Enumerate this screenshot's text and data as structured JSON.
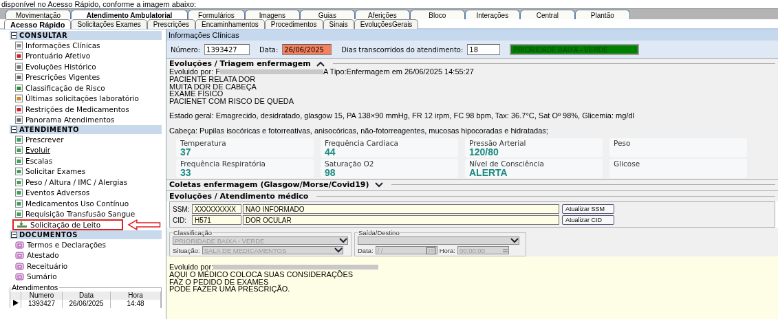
{
  "caption": "disponível no Acesso Rápido, conforme a imagem abaixo:",
  "tabs": [
    {
      "label": "Movimentação",
      "selected": false
    },
    {
      "label": "Atendimento Ambulatorial",
      "selected": true
    },
    {
      "label": "Formulários",
      "selected": false
    },
    {
      "label": "Imagens",
      "selected": false
    },
    {
      "label": "Guias",
      "selected": false
    },
    {
      "label": "Aferições",
      "selected": false
    },
    {
      "label": "Bloco",
      "selected": false
    },
    {
      "label": "Interações",
      "selected": false
    },
    {
      "label": "Central",
      "selected": false
    },
    {
      "label": "Plantão",
      "selected": false
    }
  ],
  "subtabs": [
    {
      "label": "Acesso Rápido",
      "selected": true
    },
    {
      "label": "Solicitações Exames",
      "selected": false
    },
    {
      "label": "Prescrições",
      "selected": false
    },
    {
      "label": "Encaminhamentos",
      "selected": false
    },
    {
      "label": "Procedimentos",
      "selected": false
    },
    {
      "label": "Sinais",
      "selected": false
    },
    {
      "label": "EvoluçõesGerais",
      "selected": false
    }
  ],
  "sidebar": {
    "sections": [
      {
        "title": "CONSULTAR",
        "expanded": true,
        "items": [
          {
            "label": "Informações Clínicas",
            "hovered": false,
            "highlighted": false
          },
          {
            "label": "Prontuário Afetivo",
            "hovered": false,
            "highlighted": false
          },
          {
            "label": "Evoluções Histórico",
            "hovered": false,
            "highlighted": false
          },
          {
            "label": "Prescrições Vigentes",
            "hovered": false,
            "highlighted": false
          },
          {
            "label": "Classificação de Risco",
            "hovered": false,
            "highlighted": false
          },
          {
            "label": "Últimas solicitações laboratório",
            "hovered": false,
            "highlighted": false
          },
          {
            "label": "Restrições de Medicamentos",
            "hovered": false,
            "highlighted": false
          },
          {
            "label": "Panorama Atendimentos",
            "hovered": false,
            "highlighted": false
          }
        ]
      },
      {
        "title": "ATENDIMENTO",
        "expanded": true,
        "items": [
          {
            "label": "Prescrever",
            "hovered": false,
            "highlighted": false
          },
          {
            "label": "Evoluir",
            "hovered": true,
            "highlighted": false
          },
          {
            "label": "Escalas",
            "hovered": false,
            "highlighted": false
          },
          {
            "label": "Solicitar Exames",
            "hovered": false,
            "highlighted": false
          },
          {
            "label": "Peso / Altura / IMC / Alergias",
            "hovered": false,
            "highlighted": false
          },
          {
            "label": "Eventos Adversos",
            "hovered": false,
            "highlighted": false
          },
          {
            "label": "Medicamentos Uso Contínuo",
            "hovered": false,
            "highlighted": false
          },
          {
            "label": "Requisição Transfusão Sangue",
            "hovered": false,
            "highlighted": false
          },
          {
            "label": "Solicitação de Leito",
            "hovered": false,
            "highlighted": true
          }
        ]
      },
      {
        "title": "DOCUMENTOS",
        "expanded": true,
        "items": [
          {
            "label": "Termos e Declarações",
            "hovered": false,
            "highlighted": false
          },
          {
            "label": "Atestado",
            "hovered": false,
            "highlighted": false
          },
          {
            "label": "Receituário",
            "hovered": false,
            "highlighted": false
          },
          {
            "label": "Sumário",
            "hovered": false,
            "highlighted": false
          }
        ]
      }
    ],
    "atendimentos": {
      "title": "Atendimentos",
      "columns": [
        "Numero",
        "Data",
        "Hora"
      ],
      "rows": [
        {
          "cells": [
            "1393427",
            "26/06/2025",
            "14:48"
          ],
          "selected": true
        }
      ]
    }
  },
  "panel_title": "Informações Clínicas",
  "header_fields": [
    {
      "label": "Número:",
      "value": "1393427",
      "color": "#ffffff"
    },
    {
      "label": "Data:",
      "value": "26/06/2025",
      "color": "#f4805f"
    },
    {
      "label": "Dias transcorridos do atendimento:",
      "value": "18",
      "color": "#ffffff"
    }
  ],
  "priority": {
    "value": "PRIORIDADE BAIXA - VERDE",
    "color": "#008000"
  },
  "triagem": {
    "title": "Evoluções / Triagem enfermagem",
    "expanded": true,
    "author_start": "Evoluido por: F",
    "author_end": "A Tipo:Enfermagem em 26/06/2025 14:55:27",
    "lines": [
      "PACIENTE RELATA DOR",
      "MUITA DOR DE CABEÇA",
      "EXAME FÍSICO",
      "PACIENET COM RISCO DE QUEDA"
    ],
    "paragraphs": [
      "Estado geral: Emagrecido, desidratado, glasgow 15, PA 138×90 mmHg, FR 12 irpm, FC 98 bpm, Tax: 36.7°C, Sat Oº 98%, Glicemia: mg/dl",
      "Cabeça: Pupilas isocóricas e fotorreativas, anisocóricas, não-fotorreagentes, mucosas hipocoradas e hidratadas;"
    ],
    "vitals": [
      {
        "label": "Temperatura",
        "value": "37"
      },
      {
        "label": "Frequência Cardiaca",
        "value": "44"
      },
      {
        "label": "Pressão Arterial",
        "value": "120/80"
      },
      {
        "label": "Peso"
      },
      {
        "label": "Frequência Respiratória",
        "value": "33"
      },
      {
        "label": "Saturação O2",
        "value": "98"
      },
      {
        "label": "Nível de Consciência",
        "value": "ALERTA"
      },
      {
        "label": "Glicose"
      }
    ]
  },
  "coletas": {
    "title": "Coletas enfermagem  (Glasgow/Morse/Covid19)",
    "expanded": false
  },
  "medico": {
    "title": "Evoluções / Atendimento médico",
    "codes": [
      {
        "label": "SSM:",
        "code": "XXXXXXXXX",
        "description": "NAO INFORMADO",
        "button": "Atualizar SSM"
      },
      {
        "label": "CID:",
        "code": "H571",
        "description": "DOR OCULAR",
        "button": "Atualizar CID"
      }
    ],
    "classificacao": {
      "title": "Classificação",
      "value": "PRIORIDADE BAIXA - VERDE",
      "situacao_label": "Situação:",
      "situacao": "SALA DE MEDICAMENTOS",
      "disabled": true
    },
    "saida": {
      "title": "Saída/Destino",
      "data_label": "Data:",
      "data": " / /",
      "calendar": "15",
      "hora_label": "Hora:",
      "hora": "00:00:00",
      "disabled": true
    },
    "author_start": "Evoluido por:",
    "lines": [
      "AQUI O MÉDICO COLOCA SUAS CONSIDERAÇÕES",
      "FAZ O PEDIDO DE EXAMES",
      "PODE FAZER UMA PRESCRIÇÃO."
    ]
  }
}
